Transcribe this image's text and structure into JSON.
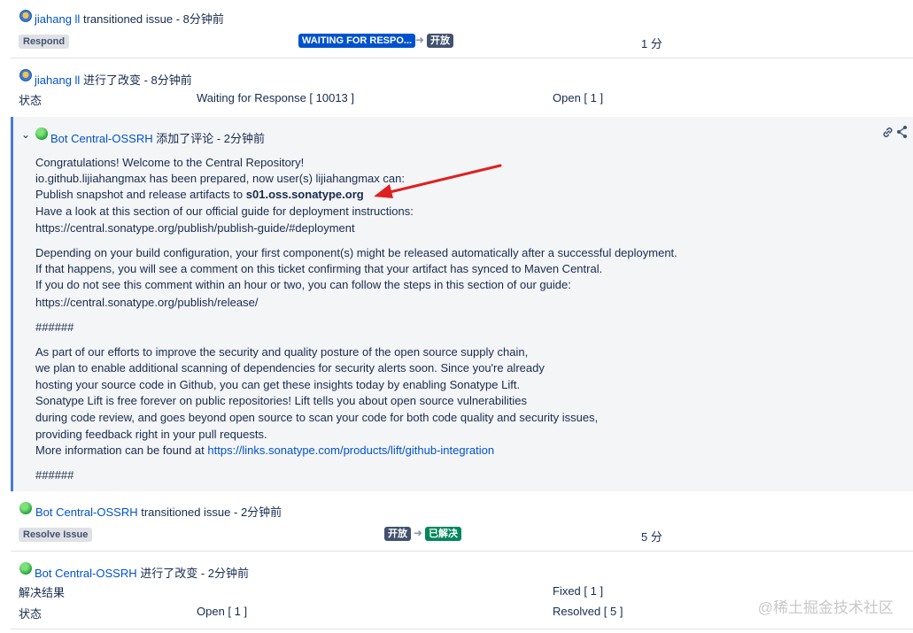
{
  "entries": {
    "e1": {
      "user": "jiahang ll",
      "action": "transitioned issue - 8分钟前",
      "button": "Respond",
      "from_status": "WAITING FOR RESPO...",
      "to_status": "开放",
      "duration": "1 分"
    },
    "e2": {
      "user": "jiahang ll",
      "action": "进行了改变 - 8分钟前",
      "field": "状态",
      "old": "Waiting for Response [ 10013 ]",
      "new": "Open [ 1 ]"
    },
    "comment": {
      "user": "Bot Central-OSSRH",
      "action": "添加了评论 - 2分钟前",
      "lines": {
        "l1": "Congratulations! Welcome to the Central Repository!",
        "l2": "io.github.lijiahangmax has been prepared, now user(s) lijiahangmax can:",
        "l3_pre": "Publish snapshot and release artifacts to ",
        "l3_bold": "s01.oss.sonatype.org",
        "l4": "Have a look at this section of our official guide for deployment instructions:",
        "l5_link": "https://central.sonatype.org/publish/publish-guide/#deployment",
        "l6": "Depending on your build configuration, your first component(s) might be released automatically after a successful deployment.",
        "l7": "If that happens, you will see a comment on this ticket confirming that your artifact has synced to Maven Central.",
        "l8": "If you do not see this comment within an hour or two, you can follow the steps in this section of our guide:",
        "l9_link": "https://central.sonatype.org/publish/release/",
        "l10": "######",
        "l11": "As part of our efforts to improve the security and quality posture of the open source supply chain,",
        "l12": "we plan to enable additional scanning of dependencies for security alerts soon. Since you're already",
        "l13": "hosting your source code in Github, you can get these insights today by enabling Sonatype Lift.",
        "l14": "Sonatype Lift is free forever on public repositories! Lift tells you about open source vulnerabilities",
        "l15": "during code review, and goes beyond open source to scan your code for both code quality and security issues,",
        "l16": "providing feedback right in your pull requests.",
        "l17_pre": "More information can be found at ",
        "l17_link": "https://links.sonatype.com/products/lift/github-integration",
        "l18": "######"
      }
    },
    "e4": {
      "user": "Bot Central-OSSRH",
      "action": "transitioned issue - 2分钟前",
      "button": "Resolve Issue",
      "from_status": "开放",
      "to_status": "已解决",
      "duration": "5 分"
    },
    "e5": {
      "user": "Bot Central-OSSRH",
      "action": "进行了改变 - 2分钟前",
      "field1": "解决结果",
      "new1": "Fixed [ 1 ]",
      "field2": "状态",
      "old2": "Open [ 1 ]",
      "new2": "Resolved [ 5 ]"
    }
  },
  "watermark": "@稀土掘金技术社区",
  "colors": {
    "accent": "#0052cc",
    "bar": "#4c7bd6",
    "arrow": "#e02020"
  }
}
